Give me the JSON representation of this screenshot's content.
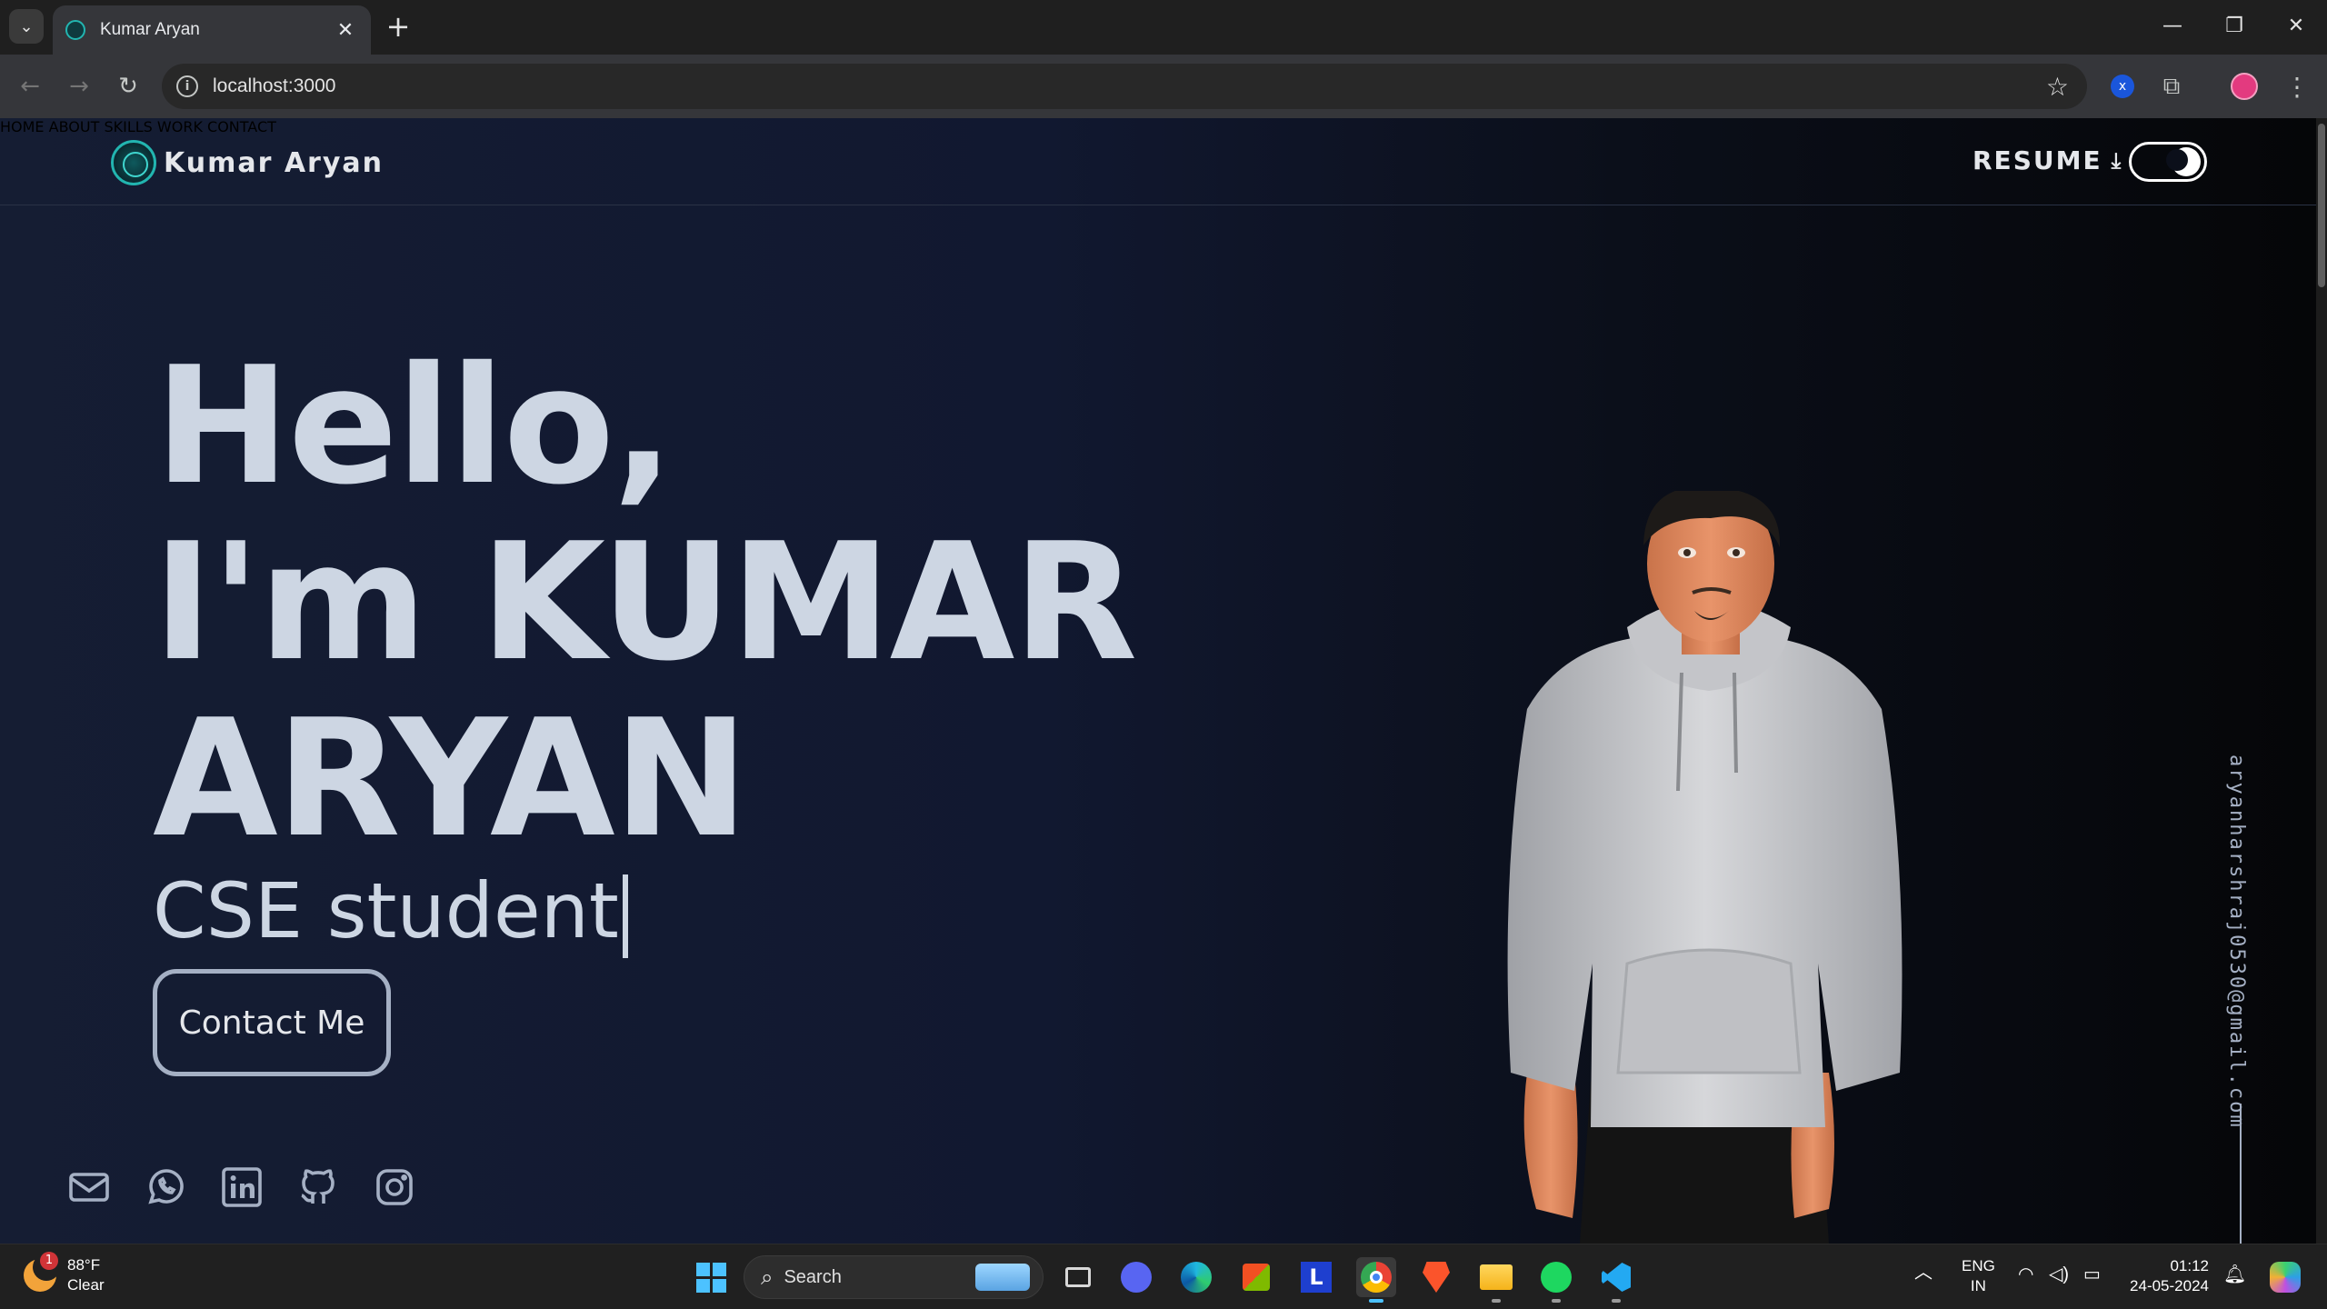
{
  "browser": {
    "tab_title": "Kumar Aryan",
    "url": "localhost:3000",
    "new_tab": "+",
    "tab_close": "✕",
    "ext_x_label": "x"
  },
  "site": {
    "brand": "Kumar Aryan",
    "nav": [
      "HOME",
      "ABOUT",
      "SKILLS",
      "WORK",
      "CONTACT"
    ],
    "resume_label": "RESUME",
    "theme_toggle": "dark"
  },
  "hero": {
    "greeting": "Hello,",
    "line2": "I'm KUMAR",
    "line3": "ARYAN",
    "role": "CSE student",
    "cta": "Contact Me"
  },
  "socials": [
    "mail-icon",
    "whatsapp-icon",
    "linkedin-icon",
    "github-icon",
    "instagram-icon"
  ],
  "email": "aryanharshraj0530@gmail.com",
  "taskbar": {
    "weather_temp": "88°F",
    "weather_cond": "Clear",
    "weather_badge": "1",
    "search_label": "Search",
    "lang_1": "ENG",
    "lang_2": "IN",
    "time": "01:12",
    "date": "24-05-2024"
  },
  "colors": {
    "accent": "#22b5b0",
    "hero_text": "#cdd6e3",
    "page_bg": "#111830"
  }
}
